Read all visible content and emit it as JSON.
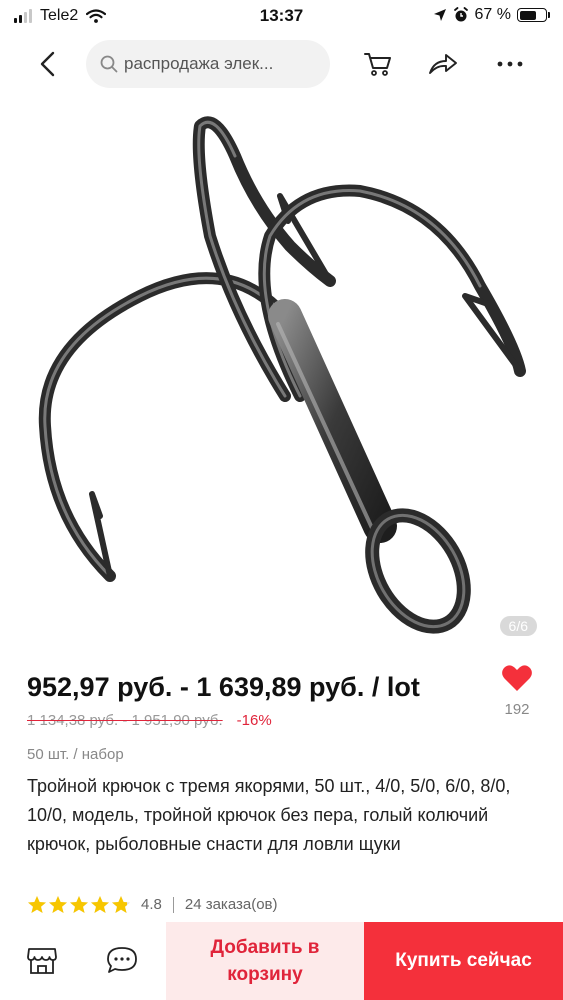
{
  "status_bar": {
    "carrier": "Tele2",
    "time": "13:37",
    "battery": "67 %",
    "battery_level": 0.67
  },
  "nav": {
    "search_placeholder": "распродажа элек...",
    "icons": [
      "back-icon",
      "search-icon",
      "cart-icon",
      "share-icon",
      "more-icon"
    ]
  },
  "product": {
    "image_counter": "6/6",
    "price": "952,97 руб. - 1 639,89 руб. / lot",
    "old_price": "1 134,38 руб. - 1 951,90 руб.",
    "discount": "-16%",
    "favorites_count": "192",
    "unit": "50 шт. / набор",
    "title": "Тройной крючок с тремя якорями, 50 шт., 4/0, 5/0, 6/0, 8/0, 10/0, модель, тройной крючок без пера, голый колючий крючок, рыболовные снасти для ловли щуки",
    "rating": "4.8",
    "rating_value": 4.8,
    "orders": "24 заказа(ов)"
  },
  "bottom_bar": {
    "add_to_cart_label": "Добавить в корзину",
    "buy_now_label": "Купить сейчас",
    "icons": [
      "store-icon",
      "chat-icon"
    ]
  },
  "colors": {
    "accent": "#f4303b",
    "discount": "#e0243a",
    "cart_bg": "#fdeaea",
    "star": "#f7c600"
  }
}
